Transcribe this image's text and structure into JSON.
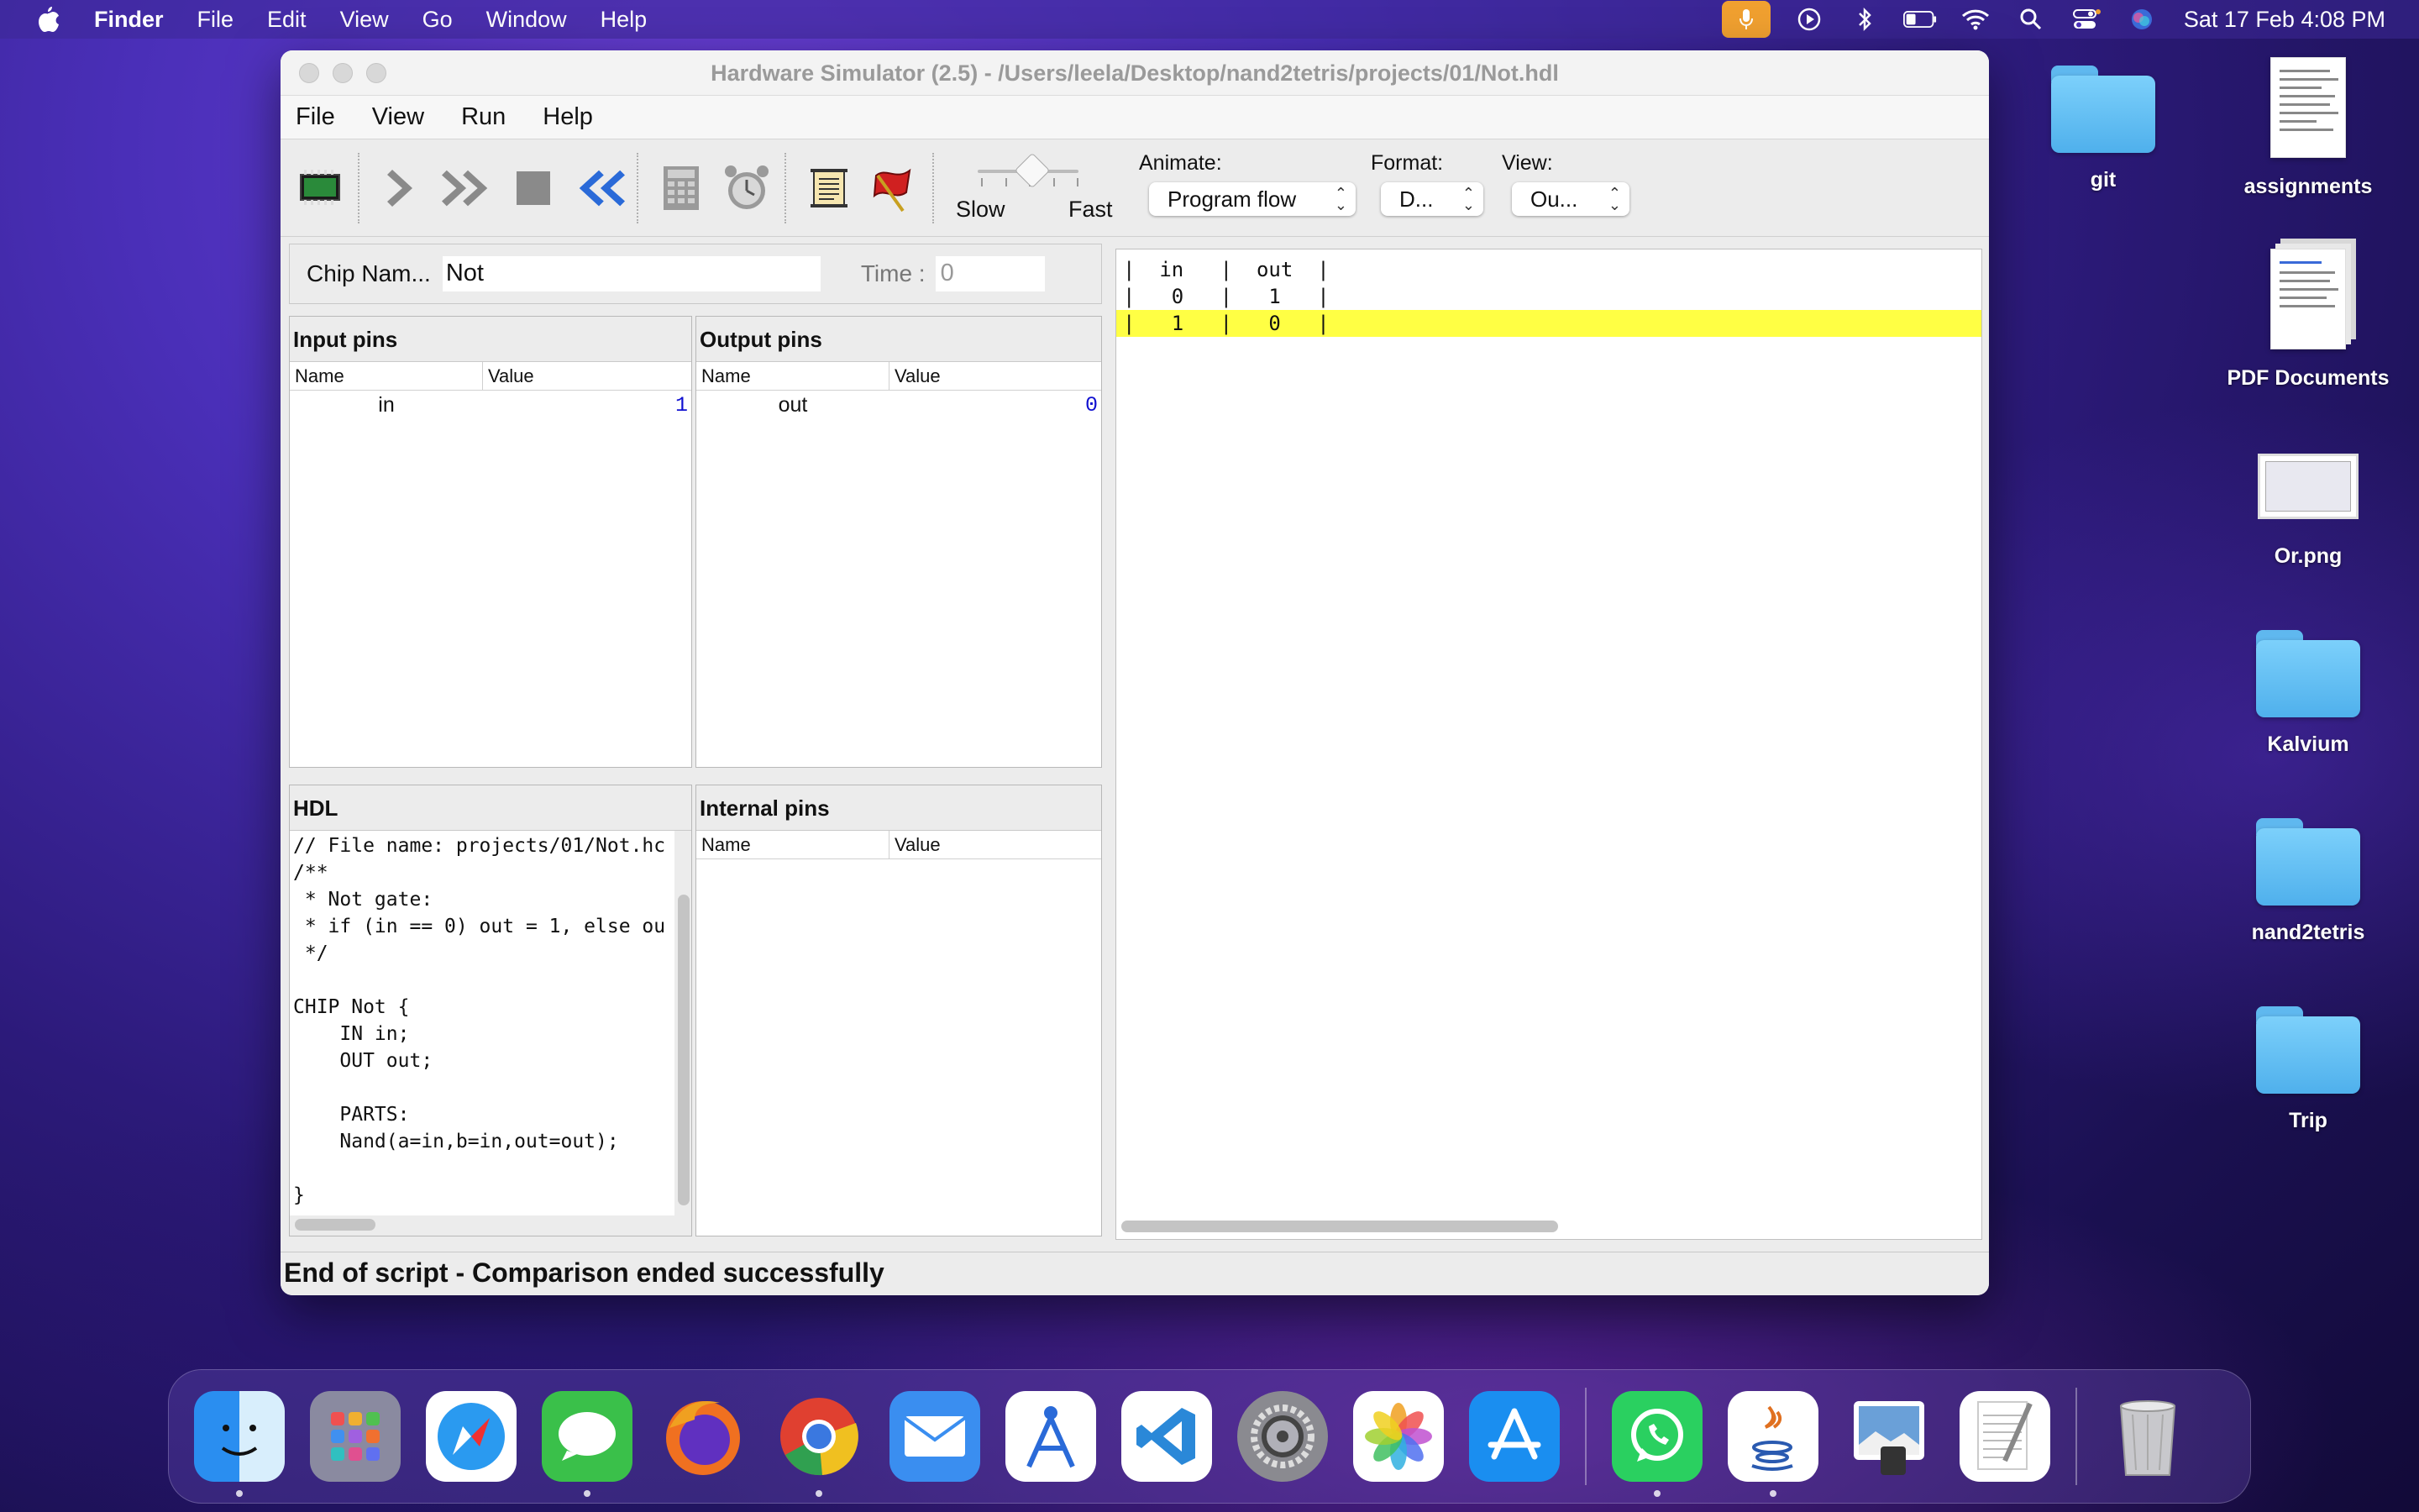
{
  "menubar": {
    "app_name": "Finder",
    "items": [
      "File",
      "Edit",
      "View",
      "Go",
      "Window",
      "Help"
    ],
    "clock": "Sat 17 Feb  4:08 PM"
  },
  "window": {
    "title": "Hardware Simulator (2.5) - /Users/leela/Desktop/nand2tetris/projects/01/Not.hdl",
    "menu": [
      "File",
      "View",
      "Run",
      "Help"
    ],
    "toolbar": {
      "slow_label": "Slow",
      "fast_label": "Fast",
      "animate_label": "Animate:",
      "animate_value": "Program flow",
      "format_label": "Format:",
      "format_value": "D...",
      "view_label": "View:",
      "view_value": "Ou..."
    },
    "chip": {
      "name_label": "Chip Nam...",
      "name_value": "Not",
      "time_label": "Time :",
      "time_value": "0"
    },
    "input_pins": {
      "title": "Input pins",
      "col_name": "Name",
      "col_value": "Value",
      "rows": [
        {
          "name": "in",
          "value": "1"
        }
      ]
    },
    "output_pins": {
      "title": "Output pins",
      "col_name": "Name",
      "col_value": "Value",
      "rows": [
        {
          "name": "out",
          "value": "0"
        }
      ]
    },
    "hdl": {
      "title": "HDL",
      "code": "// File name: projects/01/Not.hc\n/**\n * Not gate:\n * if (in == 0) out = 1, else ou\n */\n\nCHIP Not {\n    IN in;\n    OUT out;\n\n    PARTS:\n    Nand(a=in,b=in,out=out);\n\n}"
    },
    "internal_pins": {
      "title": "Internal pins",
      "col_name": "Name",
      "col_value": "Value"
    },
    "compare_output": {
      "lines": [
        "|  in   |  out  |",
        "|   0   |   1   |",
        "|   1   |   0   |"
      ],
      "highlighted_line": 2
    },
    "status": "End of script - Comparison ended successfully"
  },
  "desktop_icons": [
    {
      "label": "git",
      "kind": "folder"
    },
    {
      "label": "assignments",
      "kind": "document"
    },
    {
      "label": "PDF Documents",
      "kind": "document-stack"
    },
    {
      "label": "Or.png",
      "kind": "image"
    },
    {
      "label": "Kalvium",
      "kind": "folder"
    },
    {
      "label": "nand2tetris",
      "kind": "folder"
    },
    {
      "label": "Trip",
      "kind": "folder"
    }
  ],
  "dock": [
    {
      "name": "finder-icon",
      "running": true
    },
    {
      "name": "launchpad-icon",
      "running": false
    },
    {
      "name": "safari-icon",
      "running": false
    },
    {
      "name": "messages-icon",
      "running": true
    },
    {
      "name": "firefox-icon",
      "running": false
    },
    {
      "name": "chrome-icon",
      "running": true
    },
    {
      "name": "mail-icon",
      "running": false
    },
    {
      "name": "instruments-icon",
      "running": false
    },
    {
      "name": "vscode-icon",
      "running": false
    },
    {
      "name": "system-settings-icon",
      "running": false
    },
    {
      "name": "photos-icon",
      "running": false
    },
    {
      "name": "app-store-icon",
      "running": false
    },
    {
      "name": "whatsapp-icon",
      "running": true
    },
    {
      "name": "java-icon",
      "running": true
    },
    {
      "name": "preview-icon",
      "running": false
    },
    {
      "name": "textedit-icon",
      "running": false
    },
    {
      "name": "trash-icon",
      "running": false
    }
  ],
  "colors": {
    "highlight_row": "#ffff44",
    "pin_value": "#1010d0",
    "folder_blue": "#5fb8ef"
  }
}
